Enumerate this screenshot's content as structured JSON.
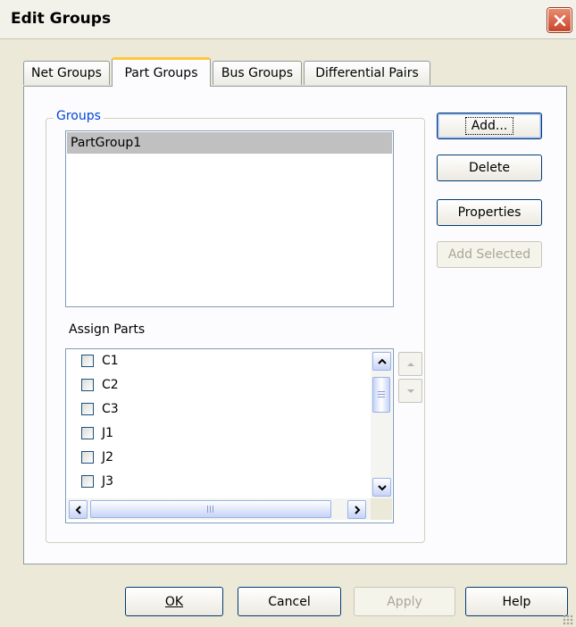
{
  "window": {
    "title": "Edit Groups"
  },
  "tabs": [
    {
      "label": "Net Groups",
      "active": false
    },
    {
      "label": "Part Groups",
      "active": true
    },
    {
      "label": "Bus Groups",
      "active": false
    },
    {
      "label": "Differential Pairs",
      "active": false
    }
  ],
  "groups": {
    "label": "Groups",
    "items": [
      "PartGroup1"
    ],
    "selected": "PartGroup1"
  },
  "assign_parts": {
    "label": "Assign Parts",
    "items": [
      {
        "label": "C1",
        "checked": false
      },
      {
        "label": "C2",
        "checked": false
      },
      {
        "label": "C3",
        "checked": false
      },
      {
        "label": "J1",
        "checked": false
      },
      {
        "label": "J2",
        "checked": false
      },
      {
        "label": "J3",
        "checked": false
      }
    ]
  },
  "side_buttons": {
    "add": "Add...",
    "delete": "Delete",
    "properties": "Properties",
    "add_selected": "Add Selected"
  },
  "footer": {
    "ok": "OK",
    "cancel": "Cancel",
    "apply": "Apply",
    "help": "Help"
  },
  "icons": {
    "close": "close-icon",
    "scroll_up": "arrow-up-icon",
    "scroll_down": "arrow-down-icon",
    "scroll_left": "arrow-left-icon",
    "scroll_right": "arrow-right-icon",
    "move_up": "move-up-icon",
    "move_down": "move-down-icon"
  },
  "colors": {
    "dialog_bg": "#ece9d8",
    "panel_bg": "#fcfcfe",
    "group_label": "#0046d5",
    "active_tab_accent": "#ffc83c",
    "selection": "#c0c0c0",
    "close_button": "#c8452a"
  }
}
